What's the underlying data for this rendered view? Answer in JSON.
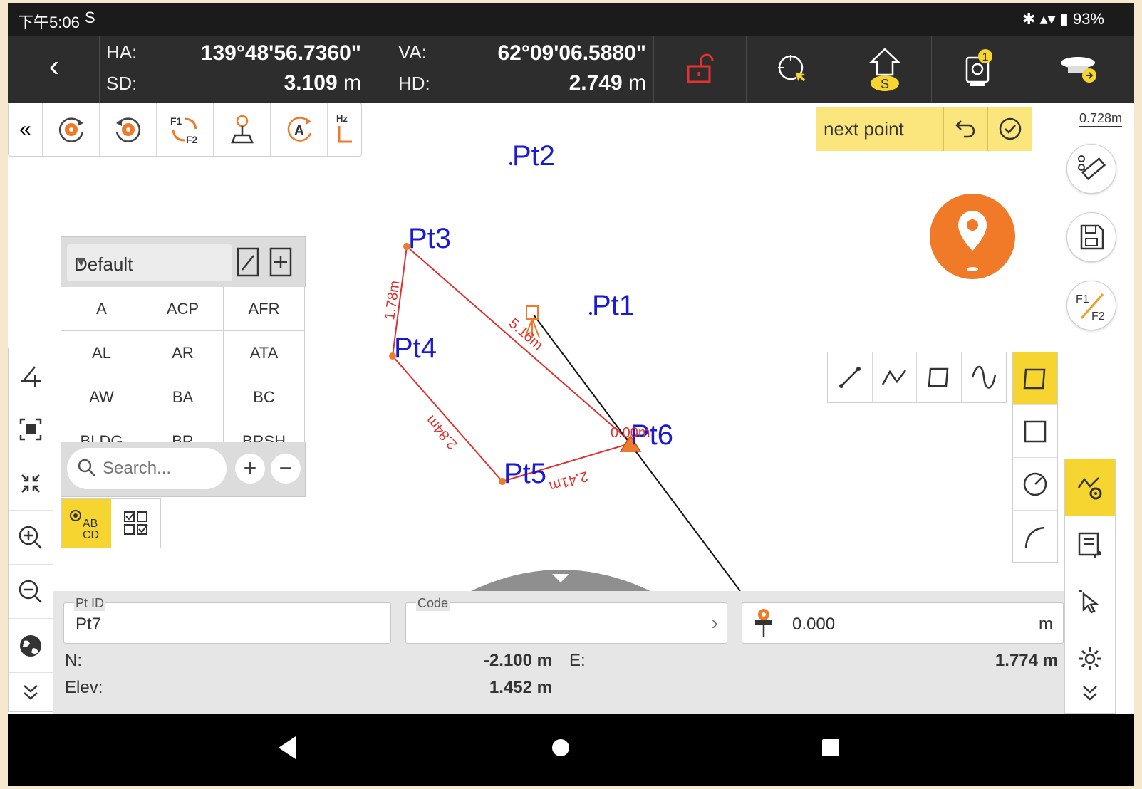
{
  "status_bar": {
    "time": "下午5:06",
    "sim_icon": "S",
    "indicators": "✱ ▴▾ ▮",
    "battery": "93%"
  },
  "measurement": {
    "ha_label": "HA:",
    "ha_value": "139°48'56.7360\"",
    "sd_label": "SD:",
    "sd_value": "3.109",
    "sd_unit": "m",
    "va_label": "VA:",
    "va_value": "62°09'06.5880\"",
    "hd_label": "HD:",
    "hd_value": "2.749",
    "hd_unit": "m",
    "header_icons": [
      "lock-open-icon",
      "target-icon",
      "station-home-icon",
      "instrument-icon",
      "receiver-icon"
    ],
    "home_badge": "S",
    "instrument_badge": "1"
  },
  "toolbar": {
    "collapse": "«",
    "icons": [
      "rotate-cw-icon",
      "rotate-ccw-icon",
      "f1-f2-swap-icon",
      "joystick-icon",
      "auto-search-icon",
      "hz-zero-icon"
    ],
    "f1_label": "F1",
    "f2_label": "F2",
    "auto_label": "A",
    "hz_label": "Hz"
  },
  "next_point": {
    "label": "next point"
  },
  "scale": {
    "label": "0.728m"
  },
  "map_points": [
    {
      "id": "Pt1"
    },
    {
      "id": "Pt2"
    },
    {
      "id": "Pt3"
    },
    {
      "id": "Pt4"
    },
    {
      "id": "Pt5"
    },
    {
      "id": "Pt6"
    }
  ],
  "map_dimensions": [
    "1.78m",
    "5.16m",
    "2.84m",
    "2.41m",
    "0.00m"
  ],
  "code_panel": {
    "layer": "Default",
    "codes": [
      [
        "A",
        "ACP",
        "AFR"
      ],
      [
        "AL",
        "AR",
        "ATA"
      ],
      [
        "AW",
        "BA",
        "BC"
      ],
      [
        "BLDG",
        "BR",
        "BRSH"
      ]
    ],
    "search_placeholder": "Search...",
    "plus": "+",
    "minus": "−"
  },
  "mode_buttons": {
    "ab": "AB",
    "cd": "CD"
  },
  "right_panel": {
    "f1": "F1",
    "f2": "F2"
  },
  "bottom_panel": {
    "pt_id_label": "Pt ID",
    "pt_id_value": "Pt7",
    "code_label": "Code",
    "code_value": "",
    "height_value": "0.000",
    "height_unit": "m",
    "n_label": "N:",
    "n_value": "-2.100 m",
    "e_label": "E:",
    "e_value": "1.774 m",
    "elev_label": "Elev:",
    "elev_value": "1.452 m"
  },
  "colors": {
    "accent_yellow": "#fbe57d",
    "active_yellow": "#f7d531",
    "orange": "#f07a28",
    "line_red": "#e03030",
    "point_blue": "#1a1ad2",
    "header_dark": "#2d2d2d"
  }
}
